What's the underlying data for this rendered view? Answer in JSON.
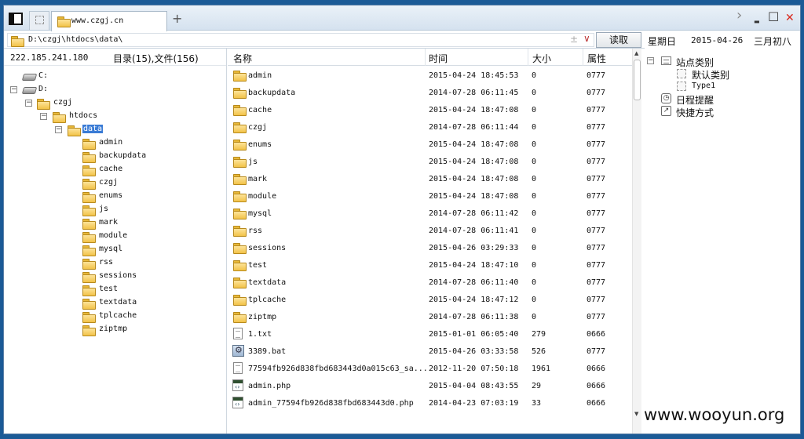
{
  "titlebar": {
    "tab_title": "www.czgj.cn",
    "new_tab": "+",
    "forward_icon": "›",
    "minimize_icon": "▬",
    "maximize_icon": "□",
    "close_icon": "✕",
    "close_color": "#d9281c"
  },
  "pathbar": {
    "path": "D:\\czgj\\htdocs\\data\\",
    "plusminus": "±",
    "dropdown_icon": "∨",
    "read_button": "读取"
  },
  "datebar": {
    "weekday": "星期日",
    "date": "2015-04-26",
    "lunar": "三月初八"
  },
  "left_panel": {
    "ip": "222.185.241.180",
    "summary": "目录(15),文件(156)",
    "drives": [
      {
        "label": "C:",
        "expander": ""
      },
      {
        "label": "D:",
        "expander": "−"
      }
    ],
    "tree": {
      "czgj": "czgj",
      "htdocs": "htdocs",
      "data": "data",
      "children": [
        "admin",
        "backupdata",
        "cache",
        "czgj",
        "enums",
        "js",
        "mark",
        "module",
        "mysql",
        "rss",
        "sessions",
        "test",
        "textdata",
        "tplcache",
        "ziptmp"
      ]
    },
    "expander_minus": "−",
    "selected_color": "#3a7bd5"
  },
  "file_list": {
    "columns": {
      "name": "名称",
      "time": "时间",
      "size": "大小",
      "attr": "属性"
    },
    "rows": [
      {
        "type": "folder",
        "name": "admin",
        "time": "2015-04-24 18:45:53",
        "size": "0",
        "attr": "0777"
      },
      {
        "type": "folder",
        "name": "backupdata",
        "time": "2014-07-28 06:11:45",
        "size": "0",
        "attr": "0777"
      },
      {
        "type": "folder",
        "name": "cache",
        "time": "2015-04-24 18:47:08",
        "size": "0",
        "attr": "0777"
      },
      {
        "type": "folder",
        "name": "czgj",
        "time": "2014-07-28 06:11:44",
        "size": "0",
        "attr": "0777"
      },
      {
        "type": "folder",
        "name": "enums",
        "time": "2015-04-24 18:47:08",
        "size": "0",
        "attr": "0777"
      },
      {
        "type": "folder",
        "name": "js",
        "time": "2015-04-24 18:47:08",
        "size": "0",
        "attr": "0777"
      },
      {
        "type": "folder",
        "name": "mark",
        "time": "2015-04-24 18:47:08",
        "size": "0",
        "attr": "0777"
      },
      {
        "type": "folder",
        "name": "module",
        "time": "2015-04-24 18:47:08",
        "size": "0",
        "attr": "0777"
      },
      {
        "type": "folder",
        "name": "mysql",
        "time": "2014-07-28 06:11:42",
        "size": "0",
        "attr": "0777"
      },
      {
        "type": "folder",
        "name": "rss",
        "time": "2014-07-28 06:11:41",
        "size": "0",
        "attr": "0777"
      },
      {
        "type": "folder",
        "name": "sessions",
        "time": "2015-04-26 03:29:33",
        "size": "0",
        "attr": "0777"
      },
      {
        "type": "folder",
        "name": "test",
        "time": "2015-04-24 18:47:10",
        "size": "0",
        "attr": "0777"
      },
      {
        "type": "folder",
        "name": "textdata",
        "time": "2014-07-28 06:11:40",
        "size": "0",
        "attr": "0777"
      },
      {
        "type": "folder",
        "name": "tplcache",
        "time": "2015-04-24 18:47:12",
        "size": "0",
        "attr": "0777"
      },
      {
        "type": "folder",
        "name": "ziptmp",
        "time": "2014-07-28 06:11:38",
        "size": "0",
        "attr": "0777"
      },
      {
        "type": "txt",
        "name": "1.txt",
        "time": "2015-01-01 06:05:40",
        "size": "279",
        "attr": "0666"
      },
      {
        "type": "bat",
        "name": "3389.bat",
        "time": "2015-04-26 03:33:58",
        "size": "526",
        "attr": "0777"
      },
      {
        "type": "txt",
        "name": "77594fb926d838fbd683443d0a015c63_sa...",
        "time": "2012-11-20 07:50:18",
        "size": "1961",
        "attr": "0666"
      },
      {
        "type": "php",
        "name": "admin.php",
        "time": "2015-04-04 08:43:55",
        "size": "29",
        "attr": "0666"
      },
      {
        "type": "php",
        "name": "admin_77594fb926d838fbd683443d0.php",
        "time": "2014-04-23 07:03:19",
        "size": "33",
        "attr": "0666"
      }
    ],
    "scroll_up": "▲",
    "scroll_down": "▼"
  },
  "right_panel": {
    "expander": "−",
    "site_category": "站点类别",
    "default_category": "默认类别",
    "type1": "Type1",
    "schedule": "日程提醒",
    "shortcut": "快捷方式"
  },
  "watermark": "www.wooyun.org"
}
